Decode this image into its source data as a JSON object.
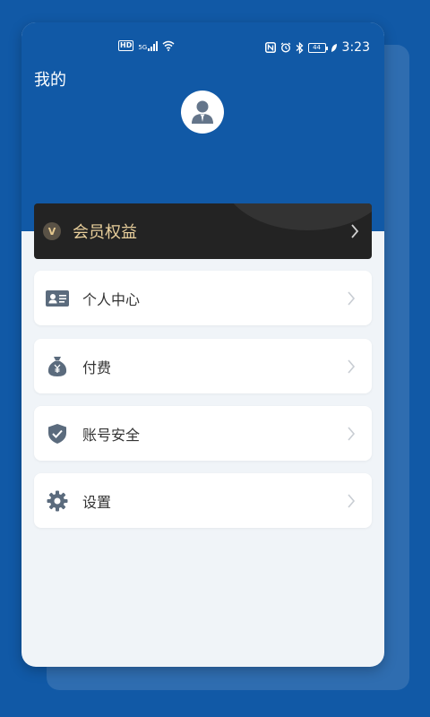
{
  "status_bar": {
    "hd": "HD",
    "network": "5G",
    "battery": "44",
    "time": "3:23"
  },
  "header": {
    "title": "我的"
  },
  "vip": {
    "badge": "V",
    "label": "会员权益"
  },
  "menu": [
    {
      "label": "个人中心",
      "icon": "id-card-icon"
    },
    {
      "label": "付费",
      "icon": "money-bag-icon"
    },
    {
      "label": "账号安全",
      "icon": "shield-check-icon"
    },
    {
      "label": "设置",
      "icon": "gear-icon"
    }
  ],
  "colors": {
    "primary": "#1159a6",
    "background": "#f0f4f8",
    "vip_bg": "#232323",
    "vip_text": "#e9cf9b",
    "icon": "#5b6b7d"
  }
}
